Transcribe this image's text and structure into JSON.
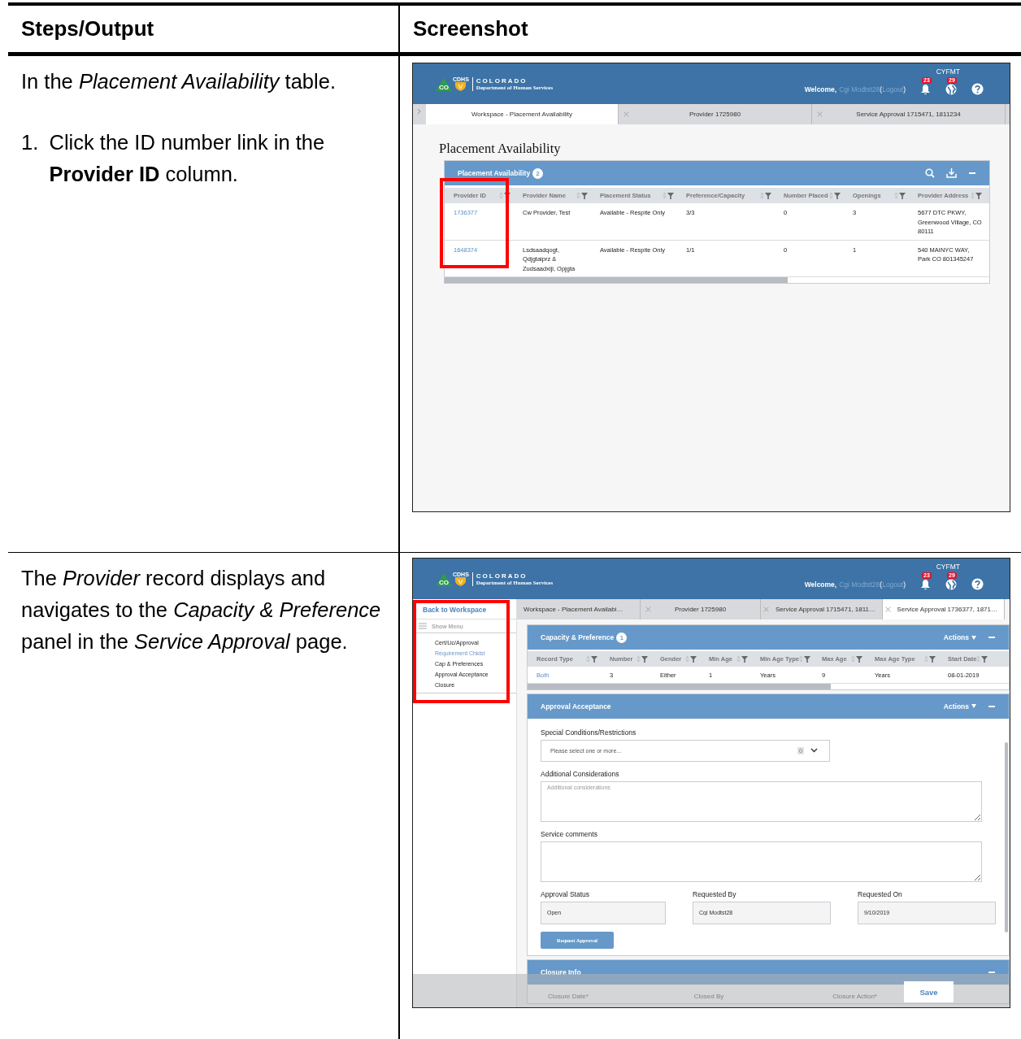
{
  "document_table": {
    "columns": [
      "Steps/Output",
      "Screenshot"
    ],
    "rows": [
      {
        "instructions": [
          {
            "kind": "paragraph",
            "text": "In the *Placement Availability* table."
          },
          {
            "kind": "step",
            "number": "1.",
            "text": "Click the ID number link in the **Provider ID** column."
          }
        ],
        "screenshot": {
          "kind": "workspace",
          "header": {
            "org": "COLORADO",
            "department": "Department of Human Services",
            "agency": "CDHS",
            "state": "CO",
            "app": "CYFMT",
            "welcome": "Welcome,",
            "user": "Cgi Modtst28",
            "paren_open": "(",
            "logout": "Logout",
            "paren_close": ")",
            "notifications": "23",
            "messages": "29"
          },
          "tabs": [
            {
              "label": "Workspace - Placement Availability",
              "closable": false,
              "selected": true
            },
            {
              "label": "Provider 1725980",
              "closable": true,
              "selected": false
            },
            {
              "label": "Service Approval 1715471, 1811234",
              "closable": true,
              "selected": false
            }
          ],
          "page_title": "Placement Availability",
          "panel": {
            "title": "Placement Availability",
            "count": "2",
            "columns": [
              {
                "label": "Provider ID",
                "kind": "link"
              },
              {
                "label": "Provider Name",
                "kind": "text"
              },
              {
                "label": "Placement Status",
                "kind": "text"
              },
              {
                "label": "Preference/Capacity",
                "kind": "text"
              },
              {
                "label": "Number Placed",
                "kind": "text"
              },
              {
                "label": "Openings",
                "kind": "text"
              },
              {
                "label": "Provider Address",
                "kind": "text"
              }
            ],
            "rows": [
              [
                "1736377",
                "Cw Provider, Test",
                "Available - Respite Only",
                "3/3",
                "0",
                "3",
                "5677 DTC PKWY, Greenwood Village, CO 80111"
              ],
              [
                "1648374",
                "Lsdsaadqogt, Qdjgtaiprz & Zudsaadxiji, Opjgta",
                "Available - Respite Only",
                "1/1",
                "0",
                "1",
                "540 MAINYC WAY, Park CO 801345247"
              ]
            ]
          }
        }
      },
      {
        "instructions": [
          {
            "kind": "paragraph",
            "text": "The *Provider* record displays and navigates to the *Capacity & Preference* panel in the *Service Approval* page."
          }
        ],
        "screenshot": {
          "kind": "service_approval",
          "header": {
            "org": "COLORADO",
            "department": "Department of Human Services",
            "agency": "CDHS",
            "state": "CO",
            "app": "CYFMT",
            "welcome": "Welcome,",
            "user": "Cgi Modtst28",
            "paren_open": "(",
            "logout": "Logout",
            "paren_close": ")",
            "notifications": "23",
            "messages": "29"
          },
          "sidebar": {
            "back": "Back to Workspace",
            "show_menu": "Show Menu",
            "items": [
              {
                "label": "Cert/Lic/Approval",
                "selected": false
              },
              {
                "label": "Requirement Chklst",
                "selected": true
              },
              {
                "label": "Cap & Preferences",
                "selected": false
              },
              {
                "label": "Approval Acceptance",
                "selected": false
              },
              {
                "label": "Closure",
                "selected": false
              }
            ]
          },
          "tabs": [
            {
              "label": "Workspace - Placement Availabi…",
              "closable": false,
              "selected": false
            },
            {
              "label": "Provider 1725980",
              "closable": true,
              "selected": false
            },
            {
              "label": "Service Approval 1715471, 1811…",
              "closable": true,
              "selected": false
            },
            {
              "label": "Service Approval 1736377, 1871…",
              "closable": true,
              "selected": true
            }
          ],
          "capacity_panel": {
            "title": "Capacity & Preference",
            "count": "1",
            "actions": "Actions",
            "columns": [
              {
                "label": "Record Type",
                "kind": "link"
              },
              {
                "label": "Number",
                "kind": "text"
              },
              {
                "label": "Gender",
                "kind": "text"
              },
              {
                "label": "Min Age",
                "kind": "text"
              },
              {
                "label": "Min Age Type",
                "kind": "text"
              },
              {
                "label": "Max Age",
                "kind": "text"
              },
              {
                "label": "Max Age Type",
                "kind": "text"
              },
              {
                "label": "Start Date",
                "kind": "text"
              }
            ],
            "rows": [
              [
                "Both",
                "3",
                "Either",
                "1",
                "Years",
                "9",
                "Years",
                "08-01-2019"
              ]
            ]
          },
          "approval_panel": {
            "title": "Approval Acceptance",
            "actions": "Actions",
            "special_conditions": {
              "label": "Special Conditions/Restrictions",
              "placeholder": "Please select one or more...",
              "count": "0"
            },
            "additional": {
              "label": "Additional Considerations",
              "placeholder": "Additional considerations"
            },
            "comments": {
              "label": "Service comments"
            },
            "fields": [
              {
                "label": "Approval Status",
                "value": "Open"
              },
              {
                "label": "Requested By",
                "value": "Cgi Modtst28"
              },
              {
                "label": "Requested On",
                "value": "9/10/2019"
              }
            ],
            "button": "Request Approval"
          },
          "closure_panel": {
            "title": "Closure Info",
            "fields": [
              "Closure Date*",
              "Closed By",
              "Closure Action*"
            ]
          },
          "save": "Save"
        }
      }
    ]
  }
}
